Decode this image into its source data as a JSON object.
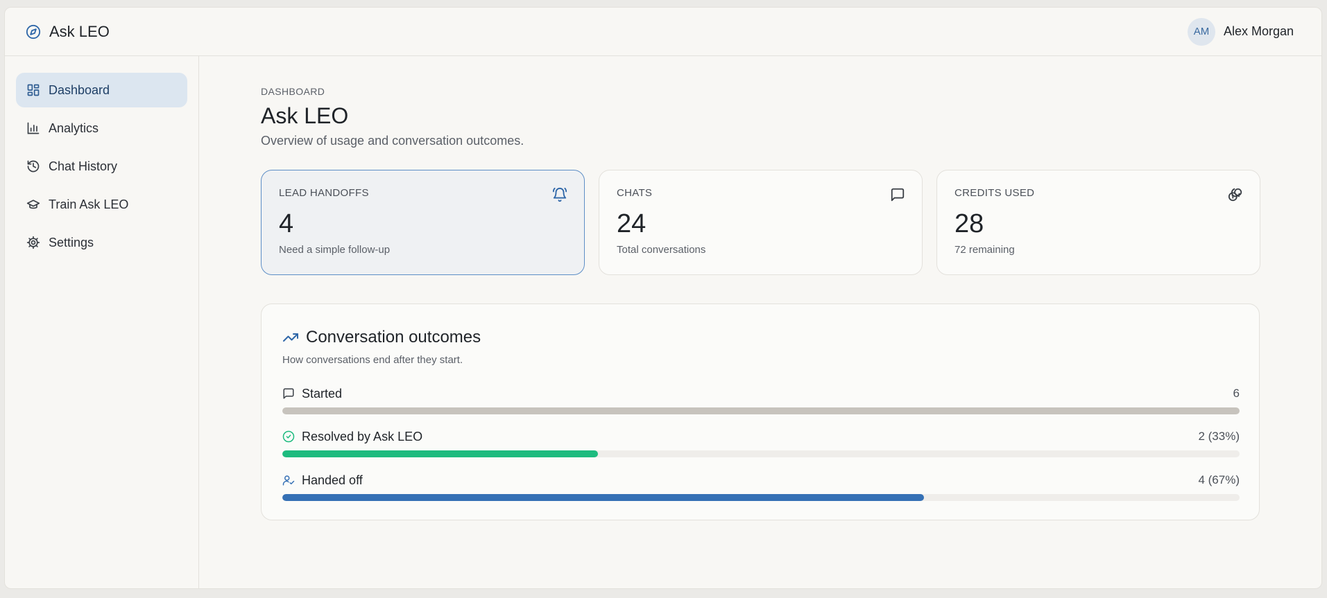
{
  "app": {
    "title": "Ask LEO"
  },
  "user": {
    "initials": "AM",
    "name": "Alex Morgan"
  },
  "sidebar": {
    "items": [
      {
        "label": "Dashboard",
        "icon": "dashboard-icon",
        "active": true
      },
      {
        "label": "Analytics",
        "icon": "bar-chart-icon",
        "active": false
      },
      {
        "label": "Chat History",
        "icon": "history-icon",
        "active": false
      },
      {
        "label": "Train Ask LEO",
        "icon": "graduation-cap-icon",
        "active": false
      },
      {
        "label": "Settings",
        "icon": "gear-icon",
        "active": false
      }
    ]
  },
  "page": {
    "eyebrow": "DASHBOARD",
    "title": "Ask LEO",
    "subtitle": "Overview of usage and conversation outcomes."
  },
  "cards": [
    {
      "label": "LEAD HANDOFFS",
      "value": "4",
      "sub": "Need a simple follow-up",
      "icon": "bell-icon",
      "highlighted": true
    },
    {
      "label": "CHATS",
      "value": "24",
      "sub": "Total conversations",
      "icon": "message-icon",
      "highlighted": false
    },
    {
      "label": "CREDITS USED",
      "value": "28",
      "sub": "72 remaining",
      "icon": "coins-icon",
      "highlighted": false
    }
  ],
  "outcomes": {
    "title": "Conversation outcomes",
    "subtitle": "How conversations end after they start.",
    "rows": [
      {
        "label": "Started",
        "value": "6",
        "fraction": 1.0,
        "color": "#c7c3bd",
        "icon": "message-icon"
      },
      {
        "label": "Resolved by Ask LEO",
        "value": "2 (33%)",
        "fraction": 0.33,
        "color": "#1dbb7f",
        "icon": "check-circle-icon"
      },
      {
        "label": "Handed off",
        "value": "4 (67%)",
        "fraction": 0.67,
        "color": "#3570b5",
        "icon": "user-check-icon"
      }
    ]
  },
  "colors": {
    "accent": "#2f67a8",
    "active_nav_bg": "#dce6f0",
    "success": "#1dbb7f"
  }
}
